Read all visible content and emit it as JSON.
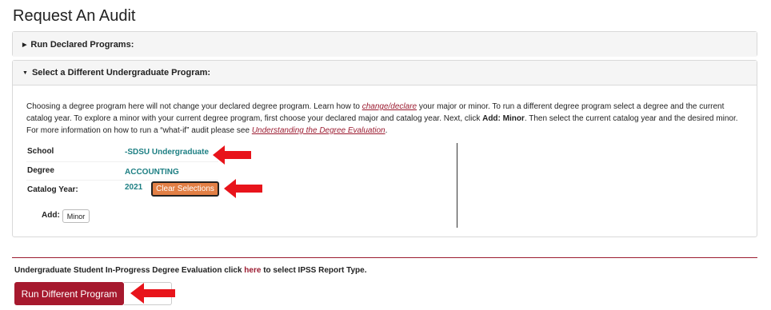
{
  "page": {
    "title": "Request An Audit"
  },
  "panels": {
    "declared": {
      "title": "Run Declared Programs:"
    },
    "different": {
      "title": "Select a Different Undergraduate Program:"
    }
  },
  "intro": {
    "t1": "Choosing a degree program here will not change your declared degree program. Learn how to ",
    "link1": "change/declare",
    "t2": " your major or minor. To run a different degree program select a degree and the current catalog year. To explore a minor with your current degree program, first choose your declared major and catalog year. Next, click ",
    "bold1": "Add: Minor",
    "t3": ". Then select the current catalog year and the desired minor. For more information on how to run a “what-if” audit please see ",
    "link2": "Understanding the Degree Evaluation",
    "t4": "."
  },
  "fields": {
    "school": {
      "label": "School",
      "value": "-SDSU Undergraduate"
    },
    "degree": {
      "label": "Degree",
      "value": "ACCOUNTING"
    },
    "catalog": {
      "label": "Catalog Year:",
      "value": "2021"
    }
  },
  "buttons": {
    "clear": "Clear Selections",
    "add_label": "Add:",
    "minor": "Minor",
    "run": "Run Different Program"
  },
  "bottom": {
    "t1": "Undergraduate Student In-Progress Degree Evaluation click ",
    "here": "here",
    "t2": " to select IPSS Report Type."
  },
  "colors": {
    "accent": "#a6192e",
    "link": "#9b1b30",
    "value": "#1d7f83",
    "clear_button": "#e27f45",
    "arrow": "#e8141b"
  }
}
